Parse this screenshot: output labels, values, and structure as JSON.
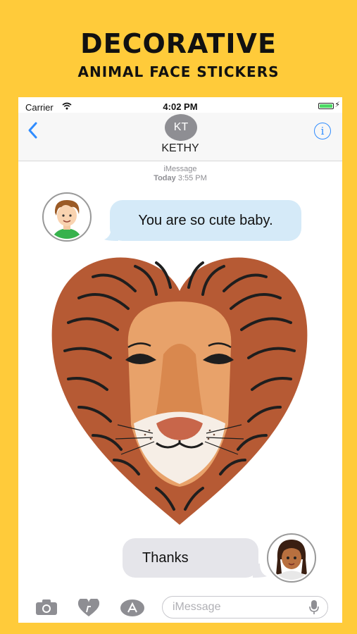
{
  "promo": {
    "title": "DECORATIVE",
    "subtitle": "ANIMAL FACE STICKERS"
  },
  "status_bar": {
    "carrier": "Carrier",
    "time": "4:02 PM",
    "battery_level": 1.0
  },
  "nav": {
    "contact_initials": "KT",
    "contact_name": "KETHY",
    "back_icon": "chevron-left-icon",
    "info_icon": "info-icon"
  },
  "thread": {
    "service": "iMessage",
    "day": "Today",
    "time": "3:55 PM"
  },
  "messages": [
    {
      "direction": "incoming",
      "text": "You are so cute baby.",
      "avatar": "boy-avatar"
    },
    {
      "direction": "incoming",
      "sticker": "lion-face-sticker"
    },
    {
      "direction": "outgoing",
      "text": "Thanks",
      "avatar": "girl-avatar"
    }
  ],
  "input_bar": {
    "placeholder": "iMessage",
    "icons": [
      "camera-icon",
      "digital-touch-icon",
      "app-store-icon",
      "microphone-icon"
    ]
  },
  "colors": {
    "background": "#FFCB3A",
    "accent": "#2F8CFF",
    "incoming_bubble": "#D5EAF8",
    "outgoing_bubble": "#E5E5EA",
    "lion_mane": "#B65A34",
    "lion_face": "#E8A26A"
  }
}
